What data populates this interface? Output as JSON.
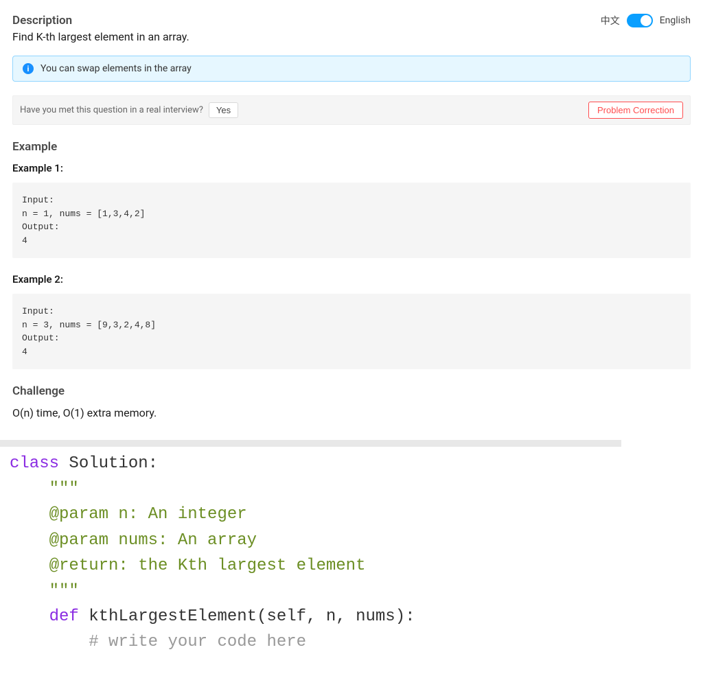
{
  "header": {
    "description_label": "Description",
    "lang": {
      "left": "中文",
      "right": "English"
    }
  },
  "problem": {
    "statement": "Find K-th largest element in an array.",
    "hint": "You can swap elements in the array"
  },
  "interview": {
    "question": "Have you met this question in a real interview?",
    "yes": "Yes",
    "correction": "Problem Correction"
  },
  "examples": {
    "header": "Example",
    "items": [
      {
        "label": "Example 1:",
        "code": "Input:\nn = 1, nums = [1,3,4,2]\nOutput:\n4"
      },
      {
        "label": "Example 2:",
        "code": "Input:\nn = 3, nums = [9,3,2,4,8]\nOutput:\n4"
      }
    ]
  },
  "challenge": {
    "header": "Challenge",
    "text": "O(n) time, O(1) extra memory."
  },
  "editor": {
    "kw_class": "class",
    "classname": "Solution:",
    "doc_open": "\"\"\"",
    "doc_l1": "@param n: An integer",
    "doc_l2": "@param nums: An array",
    "doc_l3": "@return: the Kth largest element",
    "doc_close": "\"\"\"",
    "kw_def": "def",
    "fn_sig": "kthLargestElement(self, n, nums):",
    "comment": "# write your code here"
  }
}
